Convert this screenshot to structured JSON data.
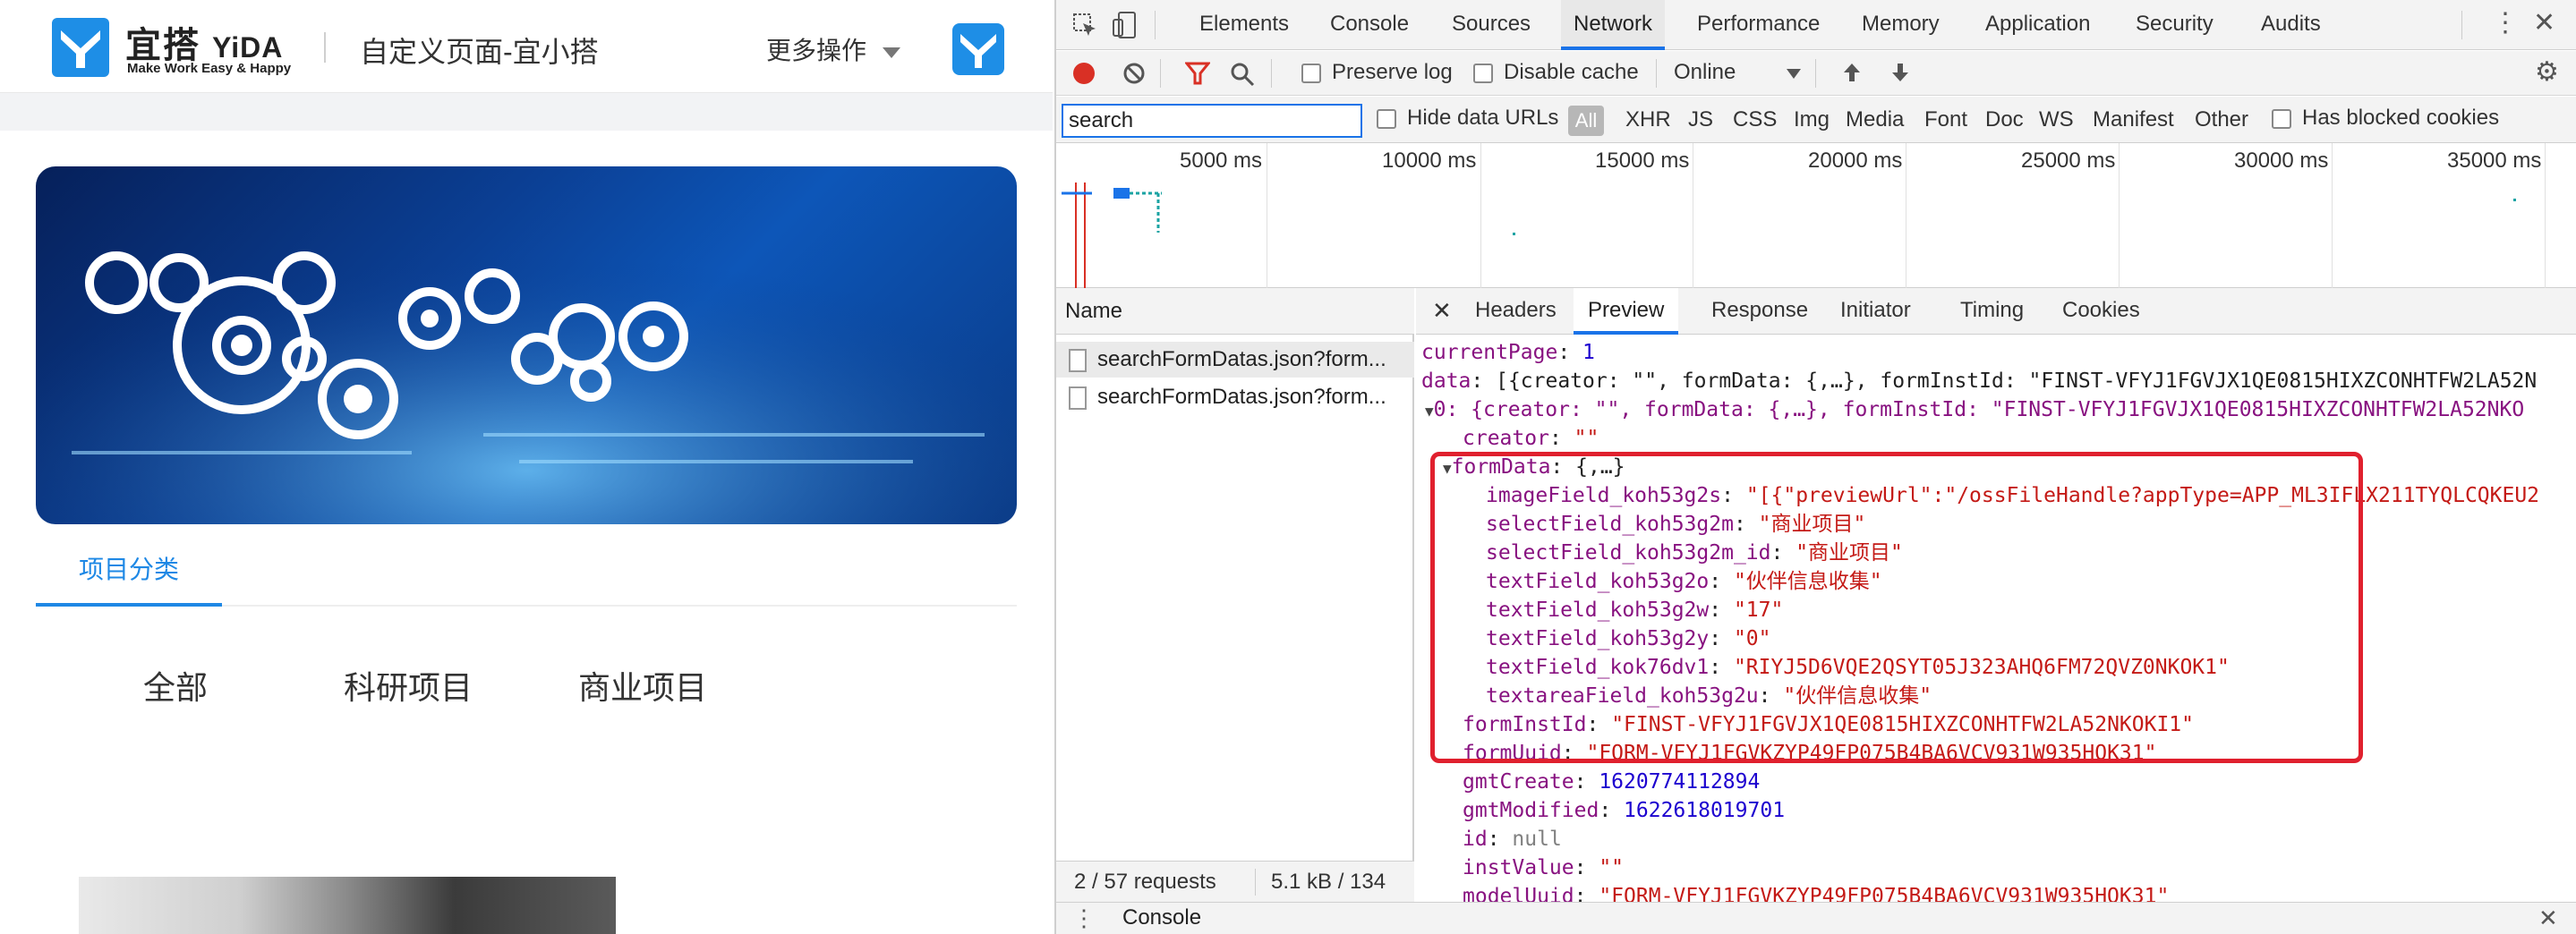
{
  "page": {
    "logo_name": "宜搭",
    "logo_en": "YiDA",
    "logo_tagline": "Make Work Easy & Happy",
    "title": "自定义页面-宜小搭",
    "more_ops": "更多操作",
    "tab_active": "项目分类",
    "categories": [
      "全部",
      "科研项目",
      "商业项目"
    ],
    "colors": {
      "brand": "#1e88e5",
      "banner": "#0b3f94"
    }
  },
  "devtools": {
    "tabs": [
      "Elements",
      "Console",
      "Sources",
      "Network",
      "Performance",
      "Memory",
      "Application",
      "Security",
      "Audits"
    ],
    "active_tab": "Network",
    "toolbar": {
      "preserve_log": "Preserve log",
      "disable_cache": "Disable cache",
      "throttle": "Online"
    },
    "filter": {
      "search_value": "search",
      "hide_data_urls": "Hide data URLs",
      "all": "All",
      "types": [
        "XHR",
        "JS",
        "CSS",
        "Img",
        "Media",
        "Font",
        "Doc",
        "WS",
        "Manifest",
        "Other"
      ],
      "blocked": "Has blocked cookies"
    },
    "timeline_labels": [
      "5000 ms",
      "10000 ms",
      "15000 ms",
      "20000 ms",
      "25000 ms",
      "30000 ms",
      "35000 ms"
    ],
    "name_header": "Name",
    "requests": [
      "searchFormDatas.json?form...",
      "searchFormDatas.json?form..."
    ],
    "status": {
      "requests": "2 / 57 requests",
      "size": "5.1 kB / 134 kB"
    },
    "detail_tabs": [
      "Headers",
      "Preview",
      "Response",
      "Initiator",
      "Timing",
      "Cookies"
    ],
    "active_detail_tab": "Preview",
    "preview": {
      "currentPage_key": "currentPage",
      "currentPage_val": "1",
      "data_summary": "[{creator: \"\", formData: {,…}, formInstId: \"FINST-VFYJ1FGVJX1QE0815HIXZCONHTFW2LA52N",
      "item0_summary": "0: {creator: \"\", formData: {,…}, formInstId: \"FINST-VFYJ1FGVJX1QE0815HIXZCONHTFW2LA52NKO",
      "creator_key": "creator",
      "creator_val": "\"\"",
      "formData_key": "formData",
      "formData_summary": "{,…}",
      "fields": [
        {
          "key": "imageField_koh53g2s",
          "val": "\"[{\"previewUrl\":\"/ossFileHandle?appType=APP_ML3IFLX211TYQLCQKEU2"
        },
        {
          "key": "selectField_koh53g2m",
          "val": "\"商业项目\""
        },
        {
          "key": "selectField_koh53g2m_id",
          "val": "\"商业项目\""
        },
        {
          "key": "textField_koh53g2o",
          "val": "\"伙伴信息收集\""
        },
        {
          "key": "textField_koh53g2w",
          "val": "\"17\""
        },
        {
          "key": "textField_koh53g2y",
          "val": "\"0\""
        },
        {
          "key": "textField_kok76dv1",
          "val": "\"RIYJ5D6VQE2QSYT05J323AHQ6FM72QVZ0NKOK1\""
        },
        {
          "key": "textareaField_koh53g2u",
          "val": "\"伙伴信息收集\""
        }
      ],
      "formInstId_key": "formInstId",
      "formInstId_val": "\"FINST-VFYJ1FGVJX1QE0815HIXZCONHTFW2LA52NKOKI1\"",
      "formUuid_key": "formUuid",
      "formUuid_val": "\"FORM-VFYJ1FGVKZYP49FP075B4BA6VCV931W935HOK31\"",
      "gmtCreate_key": "gmtCreate",
      "gmtCreate_val": "1620774112894",
      "gmtModified_key": "gmtModified",
      "gmtModified_val": "1622618019701",
      "id_key": "id",
      "id_val": "null",
      "instValue_key": "instValue",
      "instValue_val": "\"\"",
      "modelUuid_key": "modelUuid",
      "modelUuid_val": "\"FORM-VFYJ1FGVKZYP49FP075B4BA6VCV931W935HOK31\""
    },
    "drawer": "Console",
    "colors": {
      "accent": "#1a73e8",
      "highlight": "#e0202e",
      "record": "#d93025"
    }
  }
}
